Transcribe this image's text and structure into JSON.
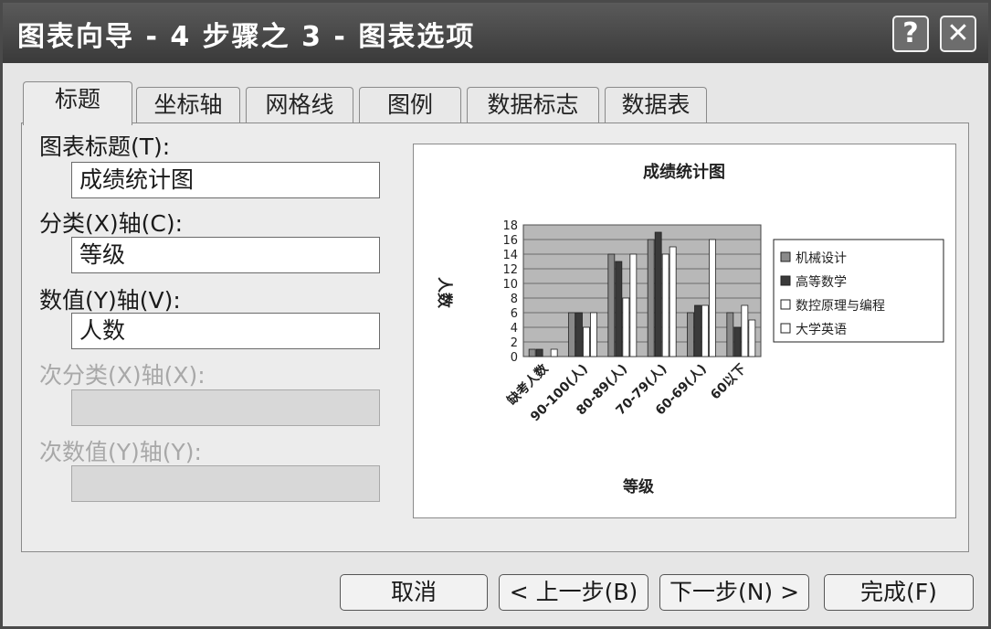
{
  "window": {
    "title": "图表向导 - 4 步骤之 3 - 图表选项",
    "help_glyph": "?",
    "close_glyph": "✕"
  },
  "tabs": [
    {
      "label": "标题",
      "active": true
    },
    {
      "label": "坐标轴"
    },
    {
      "label": "网格线"
    },
    {
      "label": "图例"
    },
    {
      "label": "数据标志"
    },
    {
      "label": "数据表"
    }
  ],
  "form": {
    "chart_title_label": "图表标题(T):",
    "chart_title_value": "成绩统计图",
    "category_axis_label": "分类(X)轴(C):",
    "category_axis_value": "等级",
    "value_axis_label": "数值(Y)轴(V):",
    "value_axis_value": "人数",
    "secondary_category_label": "次分类(X)轴(X):",
    "secondary_category_value": "",
    "secondary_value_label": "次数值(Y)轴(Y):",
    "secondary_value_value": ""
  },
  "buttons": {
    "cancel": "取消",
    "back": "< 上一步(B)",
    "next": "下一步(N) >",
    "finish": "完成(F)"
  },
  "chart_data": {
    "type": "bar",
    "title": "成绩统计图",
    "xlabel": "等级",
    "ylabel": "人数",
    "ylim": [
      0,
      18
    ],
    "yticks": [
      0,
      2,
      4,
      6,
      8,
      10,
      12,
      14,
      16,
      18
    ],
    "categories": [
      "缺考人数",
      "90-100(人)",
      "80-89(人)",
      "70-79(人)",
      "60-69(人)",
      "60以下"
    ],
    "series": [
      {
        "name": "机械设计",
        "color": "#8a8a8a",
        "values": [
          1,
          6,
          14,
          16,
          6,
          6
        ]
      },
      {
        "name": "高等数学",
        "color": "#3a3a3a",
        "values": [
          1,
          6,
          13,
          17,
          7,
          4
        ]
      },
      {
        "name": "数控原理与编程",
        "color": "#ffffff",
        "values": [
          0,
          4,
          8,
          14,
          7,
          7
        ]
      },
      {
        "name": "大学英语",
        "color": "#ffffff",
        "values": [
          1,
          6,
          14,
          15,
          16,
          5
        ]
      }
    ],
    "plot_bg": "#b8b8b8",
    "grid": true,
    "legend_position": "right"
  }
}
